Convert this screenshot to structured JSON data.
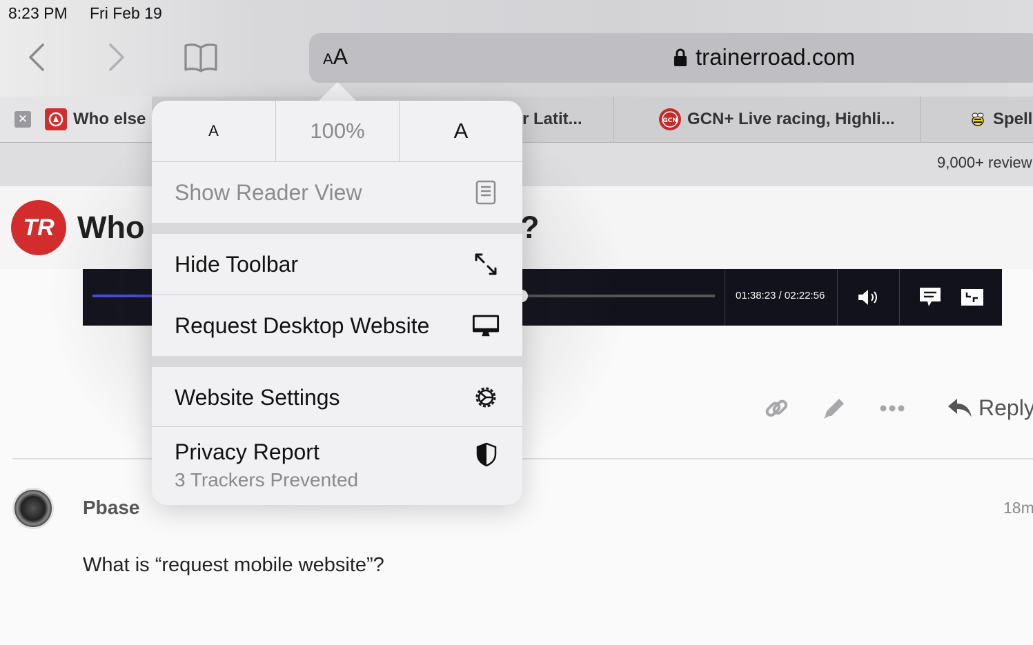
{
  "status_bar": {
    "time": "8:23 PM",
    "date": "Fri Feb 19"
  },
  "toolbar": {
    "aa_small": "A",
    "aa_large": "A",
    "url": "trainerroad.com"
  },
  "tabs": [
    {
      "label": "Who else"
    },
    {
      "label": "r Latit..."
    },
    {
      "label": "GCN+ Live racing, Highli..."
    },
    {
      "label": "Spell"
    }
  ],
  "page": {
    "banner_reviews": "9,000+ review",
    "logo_text": "TR",
    "topic_title_start": "Who",
    "topic_title_end": "?",
    "video": {
      "timecode": "01:38:23 / 02:22:56",
      "progress": 0.69
    },
    "reply_label": "Reply",
    "post": {
      "username": "Pbase",
      "time": "18m",
      "body": "What is “request mobile website”?"
    }
  },
  "popover": {
    "zoom_smaller": "A",
    "zoom_level": "100%",
    "zoom_larger": "A",
    "show_reader_view": "Show Reader View",
    "hide_toolbar": "Hide Toolbar",
    "request_desktop": "Request Desktop Website",
    "website_settings": "Website Settings",
    "privacy_report": "Privacy Report",
    "privacy_sub": "3 Trackers Prevented"
  },
  "colors": {
    "brand_red": "#d22c2c",
    "video_progress": "#4b4bd8",
    "video_bg": "#12121c"
  }
}
